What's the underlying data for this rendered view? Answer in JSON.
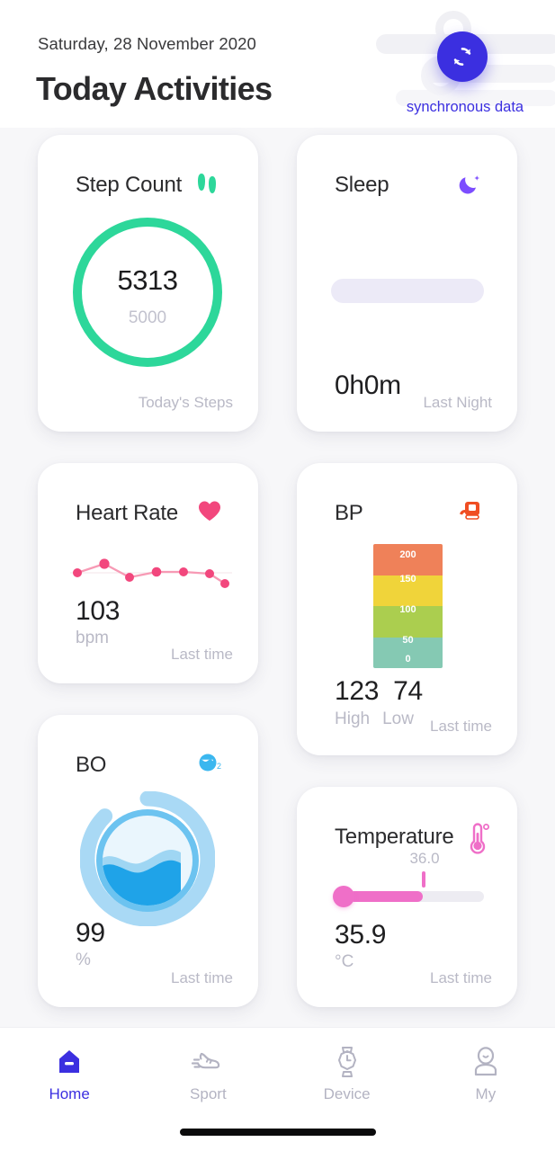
{
  "header": {
    "date": "Saturday, 28 November 2020",
    "title": "Today Activities",
    "sync_label": "synchronous data",
    "sync_icon": "refresh-sync-icon",
    "accent_color": "#3b2fe0"
  },
  "cards": {
    "step": {
      "title": "Step Count",
      "icon": "footprints-icon",
      "icon_color": "#2dd79a",
      "value": "5313",
      "goal": "5000",
      "footer": "Today's Steps",
      "ring_color": "#2dd79a"
    },
    "sleep": {
      "title": "Sleep",
      "icon": "moon-icon",
      "icon_color": "#7c4dff",
      "value": "0h0m",
      "footer": "Last Night",
      "bar_color": "#eceaf7"
    },
    "heart_rate": {
      "title": "Heart Rate",
      "icon": "heart-icon",
      "icon_color": "#f2477d",
      "value": "103",
      "unit": "bpm",
      "footer": "Last time",
      "line_color": "#f2477d"
    },
    "bp": {
      "title": "BP",
      "icon": "blood-pressure-monitor-icon",
      "icon_color": "#f04e23",
      "high_value": "123",
      "low_value": "74",
      "high_label": "High",
      "low_label": "Low",
      "footer": "Last time",
      "scale_ticks": [
        "200",
        "150",
        "100",
        "50",
        "0"
      ],
      "band_colors": [
        "#ef8159",
        "#f0d43a",
        "#abce4f",
        "#85c9b3"
      ]
    },
    "bo": {
      "title": "BO",
      "icon": "oxygen-o2-icon",
      "icon_color": "#3bb7ef",
      "value": "99",
      "unit": "%",
      "footer": "Last time",
      "water_color": "#1fa3e8"
    },
    "temperature": {
      "title": "Temperature",
      "icon": "thermometer-icon",
      "icon_color": "#ef6fc8",
      "value": "35.9",
      "unit": "°C",
      "footer": "Last time",
      "marker_label": "36.0",
      "slider_color": "#ef6fc8"
    }
  },
  "chart_data": {
    "type": "line",
    "title": "Heart Rate",
    "ylabel": "bpm",
    "x": [
      0,
      1,
      2,
      3,
      4,
      5,
      6
    ],
    "values": [
      103,
      112,
      96,
      104,
      104,
      103,
      92
    ],
    "ylim": [
      88,
      116
    ],
    "grid": false,
    "legend": "none"
  },
  "nav": {
    "items": [
      {
        "label": "Home",
        "icon": "home-icon",
        "active": true
      },
      {
        "label": "Sport",
        "icon": "running-shoe-icon",
        "active": false
      },
      {
        "label": "Device",
        "icon": "watch-icon",
        "active": false
      },
      {
        "label": "My",
        "icon": "user-profile-icon",
        "active": false
      }
    ]
  }
}
